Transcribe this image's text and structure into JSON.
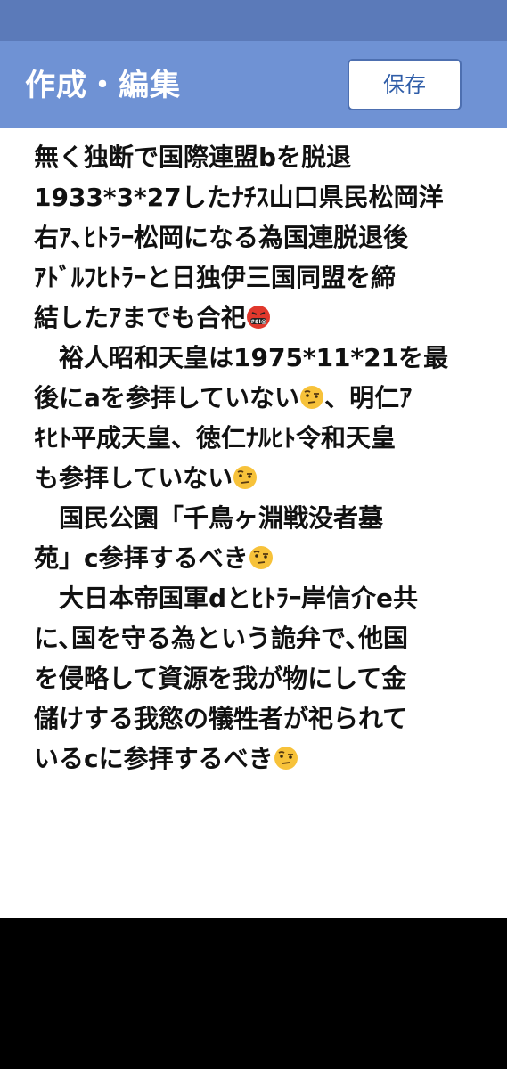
{
  "header": {
    "title": "作成・編集",
    "save_label": "保存"
  },
  "editor": {
    "lines": [
      {
        "text": "無く独断で国際連盟bを脱退",
        "emoji": null
      },
      {
        "text": "1933*3*27したﾅﾁｽ山口県民松岡洋",
        "emoji": null
      },
      {
        "text": "右ｱ､ﾋﾄﾗｰ松岡になる為国連脱退後",
        "emoji": null
      },
      {
        "text": "ｱﾄﾞﾙﾌﾋﾄﾗｰと日独伊三国同盟を締",
        "emoji": null
      },
      {
        "text": "結したｱまでも合祀",
        "emoji": "cursing-face-icon"
      },
      {
        "text": "　裕人昭和天皇は1975*11*21を最",
        "emoji": null
      },
      {
        "text": "後にaを参拝していない",
        "emoji": "raised-eyebrow-face-icon",
        "after": "、明仁ｱ"
      },
      {
        "text": "ｷﾋﾄ平成天皇、徳仁ﾅﾙﾋﾄ令和天皇",
        "emoji": null
      },
      {
        "text": "も参拝していない",
        "emoji": "raised-eyebrow-face-icon"
      },
      {
        "text": "　国民公園「千鳥ヶ淵戦没者墓",
        "emoji": null
      },
      {
        "text": "苑」c参拝するべき",
        "emoji": "raised-eyebrow-face-icon"
      },
      {
        "text": "　大日本帝国軍dとﾋﾄﾗｰ岸信介e共",
        "emoji": null
      },
      {
        "text": "に､国を守る為という詭弁で､他国",
        "emoji": null
      },
      {
        "text": "を侵略して資源を我が物にして金",
        "emoji": null
      },
      {
        "text": "儲けする我慾の犠牲者が祀られて",
        "emoji": null
      },
      {
        "text": "いるcに参拝するべき",
        "emoji": "raised-eyebrow-face-icon"
      }
    ]
  },
  "colors": {
    "status_bar": "#5b7ab9",
    "app_bar": "#6f92d4",
    "save_text": "#2f5da8",
    "text": "#111111",
    "bottom_bar": "#000000"
  }
}
